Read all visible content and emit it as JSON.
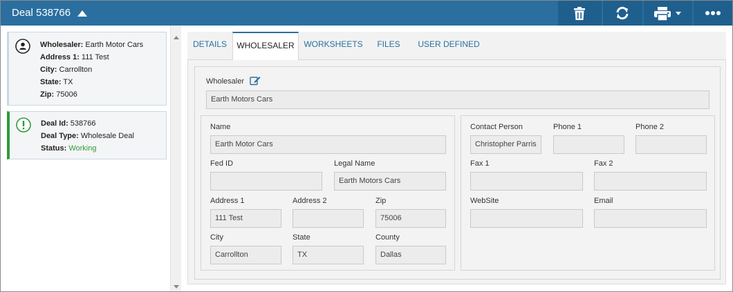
{
  "header": {
    "title": "Deal 538766",
    "icons": [
      "caret-up-icon",
      "trash-icon",
      "refresh-icon",
      "print-icon",
      "more-icon"
    ]
  },
  "sidebar": {
    "wholesaler_card": {
      "icon": "person-icon",
      "lines": [
        {
          "label": "Wholesaler:",
          "value": "Earth Motor Cars"
        },
        {
          "label": "Address 1:",
          "value": "111 Test"
        },
        {
          "label": "City:",
          "value": "Carrollton"
        },
        {
          "label": "State:",
          "value": "TX"
        },
        {
          "label": "Zip:",
          "value": "75006"
        }
      ]
    },
    "deal_card": {
      "icon": "exclamation-icon",
      "lines": [
        {
          "label": "Deal Id:",
          "value": "538766"
        },
        {
          "label": "Deal Type:",
          "value": "Wholesale Deal"
        },
        {
          "label": "Status:",
          "value": "Working"
        }
      ],
      "status_color": "#2e9a3c"
    }
  },
  "tabs": [
    "DETAILS",
    "WHOLESALER",
    "WORKSHEETS",
    "FILES",
    "USER DEFINED"
  ],
  "active_tab": "WHOLESALER",
  "form": {
    "wholesaler_label": "Wholesaler",
    "wholesaler_value": "Earth Motors Cars",
    "name_label": "Name",
    "name_value": "Earth Motor Cars",
    "fed_id_label": "Fed ID",
    "fed_id_value": "",
    "legal_name_label": "Legal Name",
    "legal_name_value": "Earth Motors Cars",
    "address1_label": "Address 1",
    "address1_value": "111 Test",
    "address2_label": "Address 2",
    "address2_value": "",
    "zip_label": "Zip",
    "zip_value": "75006",
    "city_label": "City",
    "city_value": "Carrollton",
    "state_label": "State",
    "state_value": "TX",
    "county_label": "County",
    "county_value": "Dallas",
    "contact_label": "Contact Person",
    "contact_value": "Christopher Parris",
    "phone1_label": "Phone 1",
    "phone1_value": "",
    "phone2_label": "Phone 2",
    "phone2_value": "",
    "fax1_label": "Fax 1",
    "fax1_value": "",
    "fax2_label": "Fax 2",
    "fax2_value": "",
    "website_label": "WebSite",
    "website_value": "",
    "email_label": "Email",
    "email_value": ""
  },
  "colors": {
    "header_bg": "#2a6f9f",
    "header_button_bg": "#1f5f8e",
    "accent": "#2a6f9f",
    "status_green": "#2e9a3c"
  }
}
